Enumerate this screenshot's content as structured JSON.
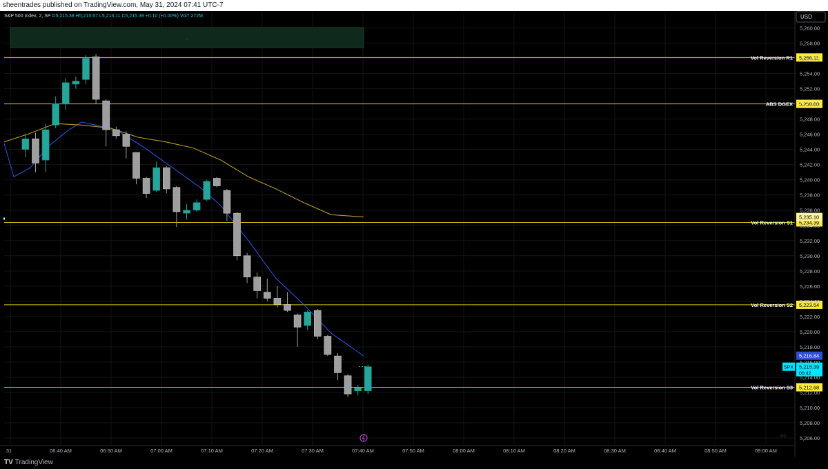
{
  "header": {
    "published": "sheentrades published on TradingView.com, May 31, 2024 07:41 UTC-7"
  },
  "legend": {
    "symbol": "S&P 500 Index, 2, SP",
    "ohlc": "O5,215.38  H5,215.67  L5,213.11  C5,215.39  +0.10 (+0.00%)  Vol7.272M"
  },
  "price_axis": {
    "currency": "USD",
    "ticks": [
      "5,260.00",
      "5,258.00",
      "5,256.00",
      "5,254.00",
      "5,252.00",
      "5,250.00",
      "5,248.00",
      "5,246.00",
      "5,244.00",
      "5,242.00",
      "5,240.00",
      "5,238.00",
      "5,236.00",
      "5,234.00",
      "5,232.00",
      "5,230.00",
      "5,228.00",
      "5,226.00",
      "5,224.00",
      "5,222.00",
      "5,220.00",
      "5,218.00",
      "5,216.00",
      "5,214.00",
      "5,212.00",
      "5,210.00",
      "5,208.00",
      "5,206.00"
    ]
  },
  "time_axis": {
    "ticks": [
      "31",
      "06:40 AM",
      "06:50 AM",
      "07:00 AM",
      "07:10 AM",
      "07:20 AM",
      "07:30 AM",
      "07:40 AM",
      "07:50 AM",
      "08:00 AM",
      "08:10 AM",
      "08:20 AM",
      "08:30 AM",
      "08:40 AM",
      "08:50 AM",
      "09:00 AM"
    ]
  },
  "levels": [
    {
      "name": "Vol Reversion R1",
      "price": 5256.11,
      "label": "5,256.11"
    },
    {
      "name": "ABS DGEX",
      "price": 5250.0,
      "label": "5,250.00"
    },
    {
      "name": "Vol Reversion S1",
      "price": 5234.39,
      "label": "5,234.39"
    },
    {
      "name": "Vol Reversion S2",
      "price": 5223.54,
      "label": "5,223.54"
    },
    {
      "name": "Vol Reversion S3",
      "price": 5212.68,
      "label": "5,212.68"
    }
  ],
  "price_tags": {
    "slow_ma": "5,235.10",
    "fast_ma": "5,216.84",
    "symbol_tag": "SPX",
    "last_price": "5,215.39",
    "countdown": "00:42"
  },
  "footer": {
    "brand": "TradingView",
    "brand_mark": "TV"
  },
  "colors": {
    "background": "#000000",
    "grid": "#141414",
    "up_candle": "#26a69a",
    "down_candle": "#9e9e9e",
    "level_line": "#d4c400",
    "level_tag": "#ffeb3b",
    "fast_ma": "#2f4fd8",
    "slow_ma": "#b79a2c",
    "last_price": "#00e5ff",
    "zone": "#0f2a1c"
  },
  "chart_data": {
    "type": "candlestick",
    "interval": "2 min",
    "x_unit": "time",
    "ylim": [
      5205.5,
      5261.5
    ],
    "candles": [
      {
        "t": "06:33",
        "o": 5244.0,
        "h": 5246.0,
        "l": 5243.0,
        "c": 5245.4
      },
      {
        "t": "06:35",
        "o": 5245.4,
        "h": 5246.2,
        "l": 5241.0,
        "c": 5242.2
      },
      {
        "t": "06:37",
        "o": 5242.6,
        "h": 5247.4,
        "l": 5241.0,
        "c": 5246.6
      },
      {
        "t": "06:39",
        "o": 5247.2,
        "h": 5251.0,
        "l": 5246.8,
        "c": 5250.0
      },
      {
        "t": "06:41",
        "o": 5250.0,
        "h": 5253.4,
        "l": 5249.2,
        "c": 5252.8
      },
      {
        "t": "06:43",
        "o": 5252.6,
        "h": 5253.6,
        "l": 5252.0,
        "c": 5253.0
      },
      {
        "t": "06:45",
        "o": 5253.2,
        "h": 5256.4,
        "l": 5252.6,
        "c": 5256.0
      },
      {
        "t": "06:47",
        "o": 5256.2,
        "h": 5256.6,
        "l": 5250.0,
        "c": 5250.6
      },
      {
        "t": "06:49",
        "o": 5250.4,
        "h": 5250.6,
        "l": 5244.4,
        "c": 5246.6
      },
      {
        "t": "06:51",
        "o": 5246.6,
        "h": 5247.0,
        "l": 5245.4,
        "c": 5245.8
      },
      {
        "t": "06:53",
        "o": 5246.0,
        "h": 5246.4,
        "l": 5242.8,
        "c": 5244.4
      },
      {
        "t": "06:55",
        "o": 5243.6,
        "h": 5243.6,
        "l": 5239.4,
        "c": 5240.2
      },
      {
        "t": "06:57",
        "o": 5240.2,
        "h": 5240.4,
        "l": 5237.6,
        "c": 5238.2
      },
      {
        "t": "06:59",
        "o": 5238.6,
        "h": 5242.4,
        "l": 5238.4,
        "c": 5241.6
      },
      {
        "t": "07:01",
        "o": 5241.6,
        "h": 5241.8,
        "l": 5238.2,
        "c": 5238.8
      },
      {
        "t": "07:03",
        "o": 5239.0,
        "h": 5239.2,
        "l": 5233.8,
        "c": 5235.8
      },
      {
        "t": "07:05",
        "o": 5235.6,
        "h": 5236.8,
        "l": 5234.8,
        "c": 5236.0
      },
      {
        "t": "07:07",
        "o": 5236.0,
        "h": 5237.4,
        "l": 5235.8,
        "c": 5237.0
      },
      {
        "t": "07:09",
        "o": 5237.4,
        "h": 5240.0,
        "l": 5237.2,
        "c": 5239.8
      },
      {
        "t": "07:11",
        "o": 5240.2,
        "h": 5240.4,
        "l": 5239.0,
        "c": 5239.2
      },
      {
        "t": "07:13",
        "o": 5238.6,
        "h": 5238.8,
        "l": 5234.6,
        "c": 5235.6
      },
      {
        "t": "07:15",
        "o": 5235.6,
        "h": 5235.8,
        "l": 5229.4,
        "c": 5230.0
      },
      {
        "t": "07:17",
        "o": 5230.0,
        "h": 5230.4,
        "l": 5226.4,
        "c": 5227.2
      },
      {
        "t": "07:19",
        "o": 5227.2,
        "h": 5227.8,
        "l": 5224.4,
        "c": 5225.4
      },
      {
        "t": "07:21",
        "o": 5225.2,
        "h": 5227.0,
        "l": 5224.0,
        "c": 5224.4
      },
      {
        "t": "07:23",
        "o": 5224.4,
        "h": 5226.0,
        "l": 5223.2,
        "c": 5223.6
      },
      {
        "t": "07:25",
        "o": 5223.6,
        "h": 5225.2,
        "l": 5222.6,
        "c": 5222.8
      },
      {
        "t": "07:27",
        "o": 5222.2,
        "h": 5222.4,
        "l": 5218.0,
        "c": 5220.6
      },
      {
        "t": "07:29",
        "o": 5220.8,
        "h": 5222.8,
        "l": 5220.2,
        "c": 5222.6
      },
      {
        "t": "07:31",
        "o": 5222.8,
        "h": 5223.0,
        "l": 5219.0,
        "c": 5219.4
      },
      {
        "t": "07:33",
        "o": 5219.4,
        "h": 5219.6,
        "l": 5216.8,
        "c": 5217.0
      },
      {
        "t": "07:35",
        "o": 5216.8,
        "h": 5217.2,
        "l": 5213.6,
        "c": 5214.6
      },
      {
        "t": "07:37",
        "o": 5214.2,
        "h": 5214.4,
        "l": 5211.4,
        "c": 5211.8
      },
      {
        "t": "07:39",
        "o": 5212.2,
        "h": 5213.0,
        "l": 5211.6,
        "c": 5212.6
      },
      {
        "t": "07:41",
        "o": 5212.2,
        "h": 5215.67,
        "l": 5211.8,
        "c": 5215.39
      }
    ],
    "series": [
      {
        "values": [
          5244.8,
          5240.4,
          5241.6,
          5244.4,
          5246.4,
          5247.6,
          5247.2,
          5246.2,
          5244.2,
          5241.6,
          5239.0,
          5236.6,
          5232.0,
          5227.0,
          5223.6,
          5219.8,
          5216.8
        ]
      },
      {
        "values": [
          5245.0,
          5246.0,
          5247.4,
          5247.2,
          5246.8,
          5245.6,
          5245.0,
          5244.2,
          5242.6,
          5240.4,
          5238.8,
          5237.0,
          5235.4,
          5235.1
        ]
      }
    ]
  }
}
